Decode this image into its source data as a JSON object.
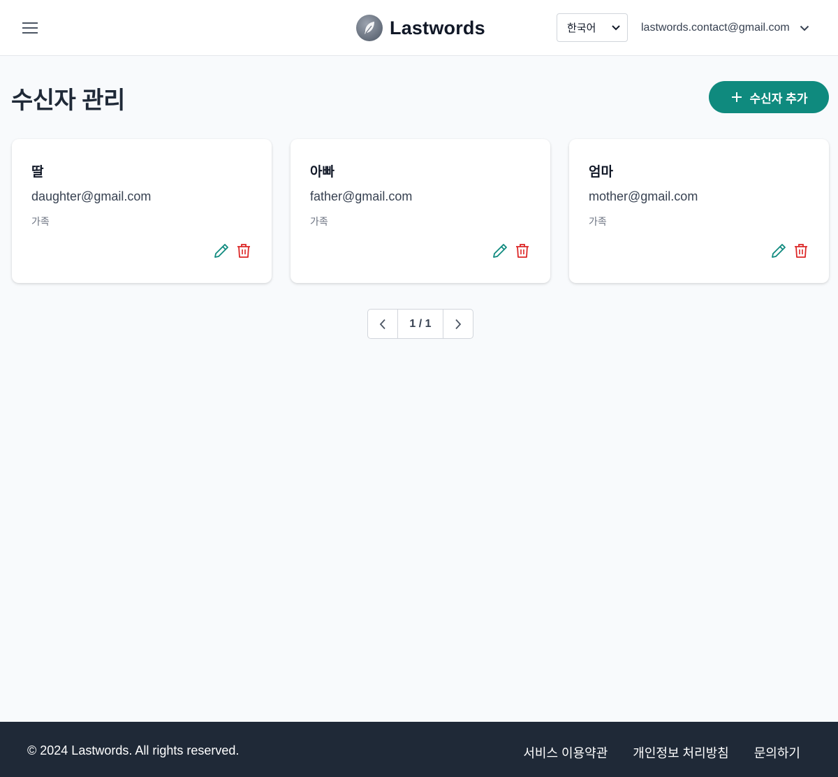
{
  "header": {
    "brand_name": "Lastwords",
    "language_selected": "한국어",
    "user_email": "lastwords.contact@gmail.com"
  },
  "main": {
    "title": "수신자 관리",
    "add_button_label": "수신자 추가"
  },
  "recipients": [
    {
      "name": "딸",
      "email": "daughter@gmail.com",
      "relation": "가족"
    },
    {
      "name": "아빠",
      "email": "father@gmail.com",
      "relation": "가족"
    },
    {
      "name": "엄마",
      "email": "mother@gmail.com",
      "relation": "가족"
    }
  ],
  "pagination": {
    "label": "1 / 1"
  },
  "footer": {
    "copyright": "© 2024 Lastwords. All rights reserved.",
    "links": [
      "서비스 이용약관",
      "개인정보 처리방침",
      "문의하기"
    ]
  },
  "colors": {
    "primary": "#0f8a7e",
    "edit_icon": "#0f8a7e",
    "delete_icon": "#dc2626",
    "footer_bg": "#1f2937"
  },
  "icons": {
    "menu": "hamburger-menu-icon",
    "logo": "feather-icon",
    "language_dropdown": "chevron-down-icon",
    "user_dropdown": "chevron-down-icon",
    "add": "plus-icon",
    "edit": "pencil-icon",
    "delete": "trash-icon",
    "prev_page": "chevron-left-icon",
    "next_page": "chevron-right-icon"
  }
}
